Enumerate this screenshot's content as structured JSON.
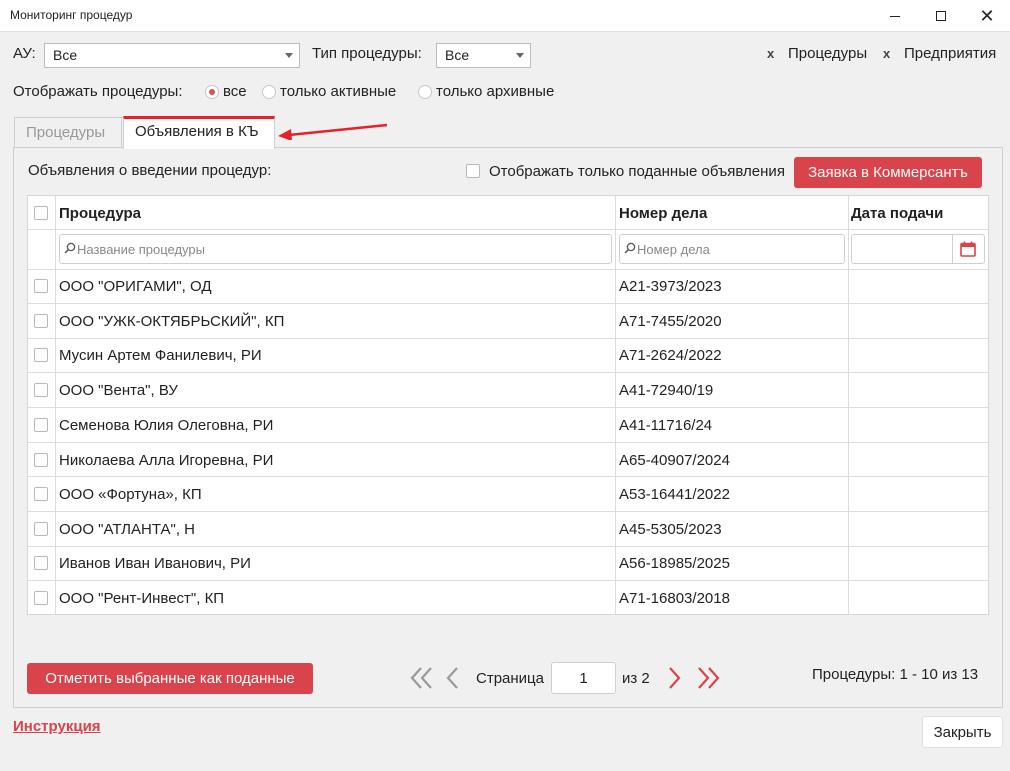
{
  "window": {
    "title": "Мониторинг процедур"
  },
  "filters": {
    "au_label": "АУ:",
    "au_value": "Все",
    "type_label": "Тип процедуры:",
    "type_value": "Все",
    "chip_procedures": "Процедуры",
    "chip_enterprises": "Предприятия",
    "chip_remove_glyph": "x"
  },
  "display": {
    "label": "Отображать процедуры:",
    "options": [
      {
        "label": "все",
        "selected": true
      },
      {
        "label": "только активные",
        "selected": false
      },
      {
        "label": "только архивные",
        "selected": false
      }
    ]
  },
  "tabs": [
    {
      "label": "Процедуры",
      "active": false
    },
    {
      "label": "Объявления в КЪ",
      "active": true
    }
  ],
  "panel": {
    "heading": "Объявления о введении процедур:",
    "only_submitted_label": "Отображать только поданные объявления",
    "kommersant_button": "Заявка в Коммерсантъ"
  },
  "table": {
    "columns": [
      "Процедура",
      "Номер дела",
      "Дата подачи"
    ],
    "filter_placeholders": {
      "procedure": "Название процедуры",
      "case": "Номер дела"
    },
    "rows": [
      {
        "procedure": "ООО \"ОРИГАМИ\", ОД",
        "case": "А21-3973/2023",
        "date": ""
      },
      {
        "procedure": "ООО \"УЖК-ОКТЯБРЬСКИЙ\", КП",
        "case": "А71-7455/2020",
        "date": ""
      },
      {
        "procedure": "Мусин Артем Фанилевич, РИ",
        "case": "А71-2624/2022",
        "date": ""
      },
      {
        "procedure": "ООО \"Вента\", ВУ",
        "case": "А41-72940/19",
        "date": ""
      },
      {
        "procedure": "Семенова Юлия Олеговна, РИ",
        "case": "А41-11716/24",
        "date": ""
      },
      {
        "procedure": "Николаева Алла Игоревна, РИ",
        "case": "А65-40907/2024",
        "date": ""
      },
      {
        "procedure": "ООО «Фортуна», КП",
        "case": "А53-16441/2022",
        "date": ""
      },
      {
        "procedure": "ООО \"АТЛАНТА\", Н",
        "case": "А45-5305/2023",
        "date": ""
      },
      {
        "procedure": "Иванов Иван Иванович, РИ",
        "case": "А56-18985/2025",
        "date": ""
      },
      {
        "procedure": "ООО \"Рент-Инвест\", КП",
        "case": "А71-16803/2018",
        "date": ""
      }
    ]
  },
  "footer": {
    "mark_button": "Отметить выбранные как поданные",
    "page_label": "Страница",
    "page_value": "1",
    "page_of": "из 2",
    "summary": "Процедуры: 1 - 10 из 13",
    "instruction_link": "Инструкция",
    "close_button": "Закрыть"
  },
  "colors": {
    "accent": "#d9434b",
    "tab_active_border": "#e8202a"
  }
}
